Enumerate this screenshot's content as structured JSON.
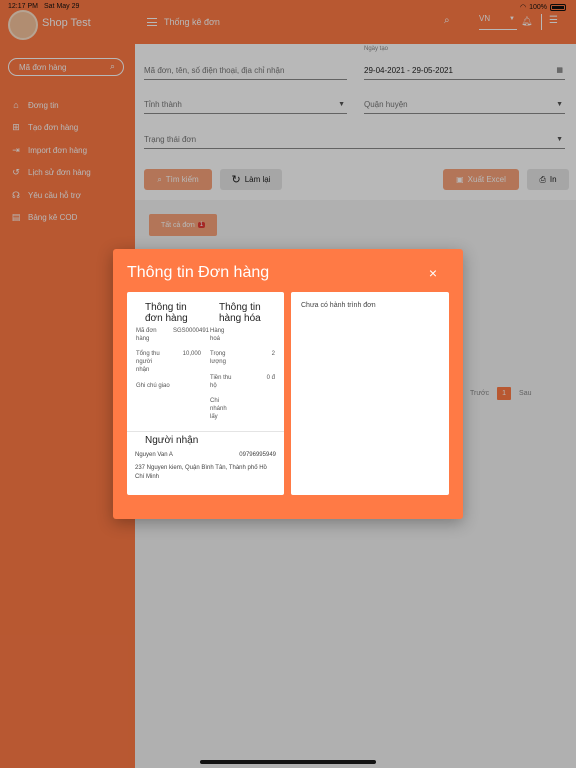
{
  "status_bar": {
    "time": "12:17 PM",
    "date": "Sat May 29",
    "battery": "100%"
  },
  "sidebar": {
    "shop_name": "Shop Test",
    "search_placeholder": "Mã đơn hàng",
    "items": [
      {
        "label": "Đơng tin",
        "icon": "home-icon"
      },
      {
        "label": "Tạo đơn hàng",
        "icon": "add-box-icon"
      },
      {
        "label": "Import đơn hàng",
        "icon": "import-icon"
      },
      {
        "label": "Lịch sử đơn hàng",
        "icon": "history-icon"
      },
      {
        "label": "Yêu cầu hỗ trợ",
        "icon": "support-icon"
      },
      {
        "label": "Bảng kê COD",
        "icon": "document-icon"
      }
    ]
  },
  "header": {
    "title": "Thống kê đơn",
    "language": "VN"
  },
  "filters": {
    "search_placeholder": "Mã đơn, tên, số điện thoại, địa chỉ nhận",
    "date_label": "Ngày tạo",
    "date_range": "29-04-2021 - 29-05-2021",
    "province_placeholder": "Tỉnh thành",
    "district_placeholder": "Quận huyện",
    "status_placeholder": "Trạng thái đơn",
    "search_button": "Tìm kiếm",
    "reset_button": "Làm lại",
    "excel_button": "Xuất Excel",
    "print_button": "In"
  },
  "order_tab": {
    "label": "Tất cả đơn",
    "count": "1"
  },
  "pagination": {
    "prev": "Trước",
    "current": "1",
    "next": "Sau"
  },
  "modal": {
    "title": "Thông tin Đơn hàng",
    "close_symbol": "×",
    "order_section": {
      "heading": "Thông tin đơn hàng",
      "order_code_label": "Mã đơn hàng",
      "order_code": "SGS0000491",
      "collect_label": "Tổng thu người nhận",
      "collect_value": "10,000",
      "note_label": "Ghi chú giao",
      "note_value": ""
    },
    "goods_section": {
      "heading": "Thông tin hàng hóa",
      "goods_label": "Hàng hoá",
      "goods_value": "",
      "weight_label": "Trọng lượng",
      "weight_value": "2",
      "cod_label": "Tiền thu hộ",
      "cod_value": "0 đ",
      "branch_label": "Chi nhánh lấy",
      "branch_value": ""
    },
    "receiver_section": {
      "heading": "Người nhận",
      "name": "Nguyen Van A",
      "phone": "09796995949",
      "address": "237 Nguyen kiem, Quận Bình Tân, Thành phố Hồ Chí Minh"
    },
    "route_empty_text": "Chưa có hành trình đơn"
  },
  "colors": {
    "accent": "#ff7a45",
    "button_light": "#f9a37a",
    "badge": "#e53935"
  }
}
